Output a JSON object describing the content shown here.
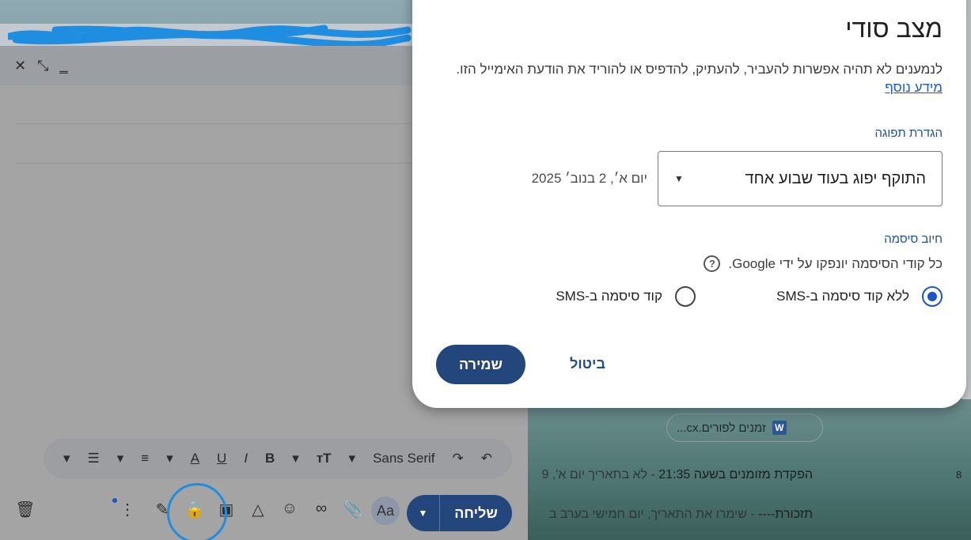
{
  "background": {
    "chip_label": "זמנים לפורים.cx...",
    "rows": [
      {
        "title": "הפקדת מזומנים בשעה 21:35",
        "snippet": " - לא בתאריך יום א', 9"
      },
      {
        "title": "תזכורת----",
        "snippet": " - שימרו את התאריך, יום חמישי בערב ב"
      }
    ],
    "row_date": "8"
  },
  "compose": {
    "header_icons": [
      "close-icon",
      "expand-icon",
      "minimize-icon"
    ],
    "font_name": "Sans Serif",
    "send_label": "שליחה",
    "aa_label": "Aa"
  },
  "dialog": {
    "title": "מצב סודי",
    "description": "לנמענים לא תהיה אפשרות להעביר, להעתיק, להדפיס או להוריד את הודעת האימייל הזו.",
    "learn_more": "מידע נוסף",
    "expiry_label": "הגדרת תפוגה",
    "expiry_value": "התוקף יפוג בעוד שבוע אחד",
    "expiry_date": "יום א׳, 2 בנוב׳ 2025",
    "password_label": "חיוב סיסמה",
    "password_desc": "כל קודי הסיסמה יונפקו על ידי Google.",
    "option_no_sms": "ללא קוד סיסמה ב-SMS",
    "option_sms": "קוד סיסמה ב-SMS",
    "selected_option": "option_no_sms",
    "cancel_label": "ביטול",
    "save_label": "שמירה"
  },
  "colors": {
    "primary": "#23477d",
    "accent_blue": "#1a56c9",
    "annotation_blue": "#1f8de0"
  }
}
